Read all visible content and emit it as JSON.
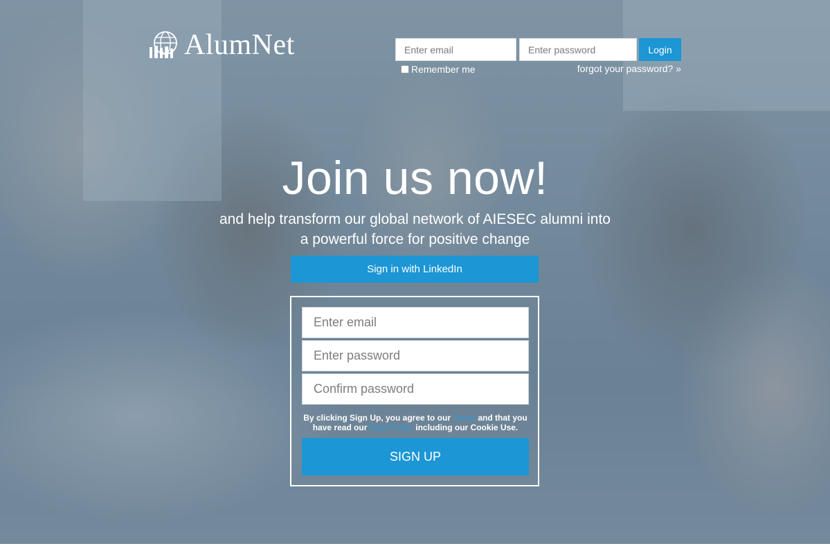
{
  "brand": {
    "name": "AlumNet",
    "accent_color": "#1c96d4"
  },
  "header": {
    "email_placeholder": "Enter email",
    "password_placeholder": "Enter password",
    "login_label": "Login",
    "remember_label": "Remember me",
    "forgot_label": "forgot your password? »"
  },
  "hero": {
    "title": "Join us now!",
    "subtitle_line1": "and help transform our global network of AIESEC alumni into",
    "subtitle_line2": "a powerful force for positive change",
    "linkedin_label": "Sign in with LinkedIn"
  },
  "signup": {
    "email_placeholder": "Enter email",
    "password_placeholder": "Enter password",
    "confirm_placeholder": "Confirm password",
    "terms_prefix": "By clicking Sign Up, you agree to our ",
    "terms_link": "Terms",
    "terms_middle": " and that you have read our ",
    "policy_link": "Data Policy,",
    "terms_suffix": " including our Cookie Use.",
    "button_label": "SIGN UP"
  },
  "icons": {
    "logo_icon": "globe-people-icon",
    "remember_checkbox": "checkbox-icon"
  }
}
